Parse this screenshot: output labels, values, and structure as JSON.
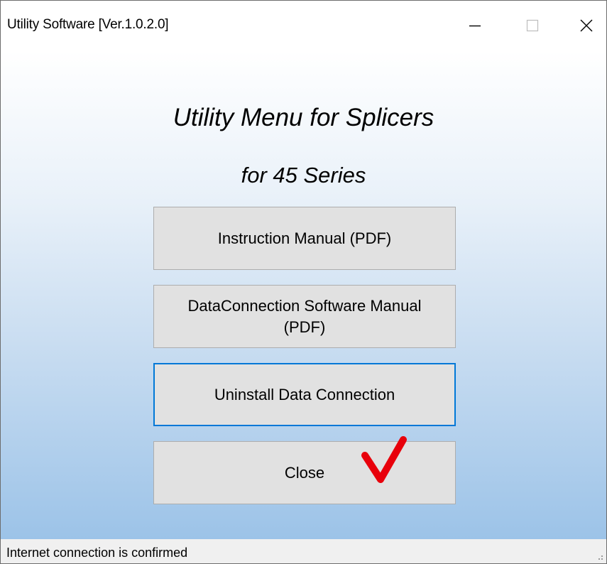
{
  "window": {
    "title": "Utility Software [Ver.1.0.2.0]",
    "minimize_icon": "minimize-icon",
    "maximize_icon": "maximize-icon",
    "close_icon": "close-icon"
  },
  "main": {
    "heading": "Utility Menu for Splicers",
    "subheading": "for 45 Series",
    "buttons": [
      {
        "label": "Instruction Manual (PDF)"
      },
      {
        "label": "DataConnection Software Manual (PDF)"
      },
      {
        "label": "Uninstall Data Connection",
        "focused": true
      },
      {
        "label": "Close"
      }
    ],
    "annotation_icon": "red-checkmark-icon",
    "annotation_color": "#e8000b"
  },
  "status_bar": {
    "text": "Internet connection is confirmed"
  },
  "colors": {
    "focus_border": "#0078d7",
    "button_face": "#e1e1e1",
    "gradient_bottom": "#9cc3e8"
  }
}
